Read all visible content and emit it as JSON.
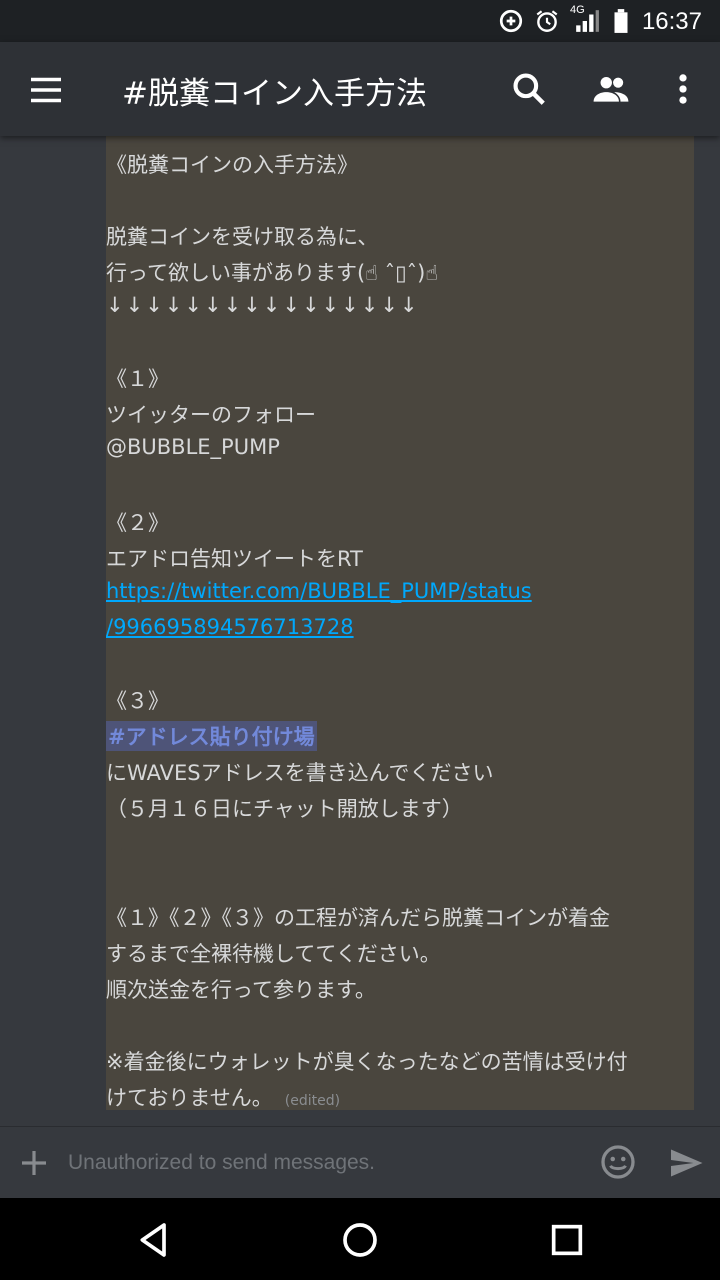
{
  "status_bar": {
    "time": "16:37",
    "network": "4G",
    "icons": [
      "data-saver-icon",
      "alarm-icon",
      "signal-icon",
      "battery-icon"
    ]
  },
  "app_bar": {
    "title": "#脱糞コイン入手方法",
    "icons": [
      "menu-icon",
      "search-icon",
      "members-icon",
      "overflow-icon"
    ]
  },
  "message": {
    "lines": [
      "《脱糞コインの入手方法》",
      "脱糞コインを受け取る為に、",
      "行って欲しい事があります(☝ ˆ▯ˆ)☝",
      "↓↓↓↓↓↓↓↓↓↓↓↓↓↓↓↓",
      "《１》",
      "ツイッターのフォロー",
      "@BUBBLE_PUMP",
      "《２》",
      "エアドロ告知ツイートをRT",
      "https://twitter.com/BUBBLE_PUMP/status",
      "/996695894576713728",
      "《３》",
      "#アドレス貼り付け場",
      "にWAVESアドレスを書き込んでください",
      "（５月１６日にチャット開放します）",
      "《１》《２》《３》の工程が済んだら脱糞コインが着金",
      "するまで全裸待機しててください。",
      "順次送金を行って参ります。",
      "※着金後にウォレットが臭くなったなどの苦情は受け付",
      "けておりません。"
    ],
    "edited_label": "(edited)"
  },
  "input_bar": {
    "placeholder": "Unauthorized to send messages."
  },
  "colors": {
    "background": "#36393e",
    "app_bar": "#2e3136",
    "message_highlight": "#4a463e",
    "link": "#00a8fc",
    "mention": "#7289da"
  }
}
